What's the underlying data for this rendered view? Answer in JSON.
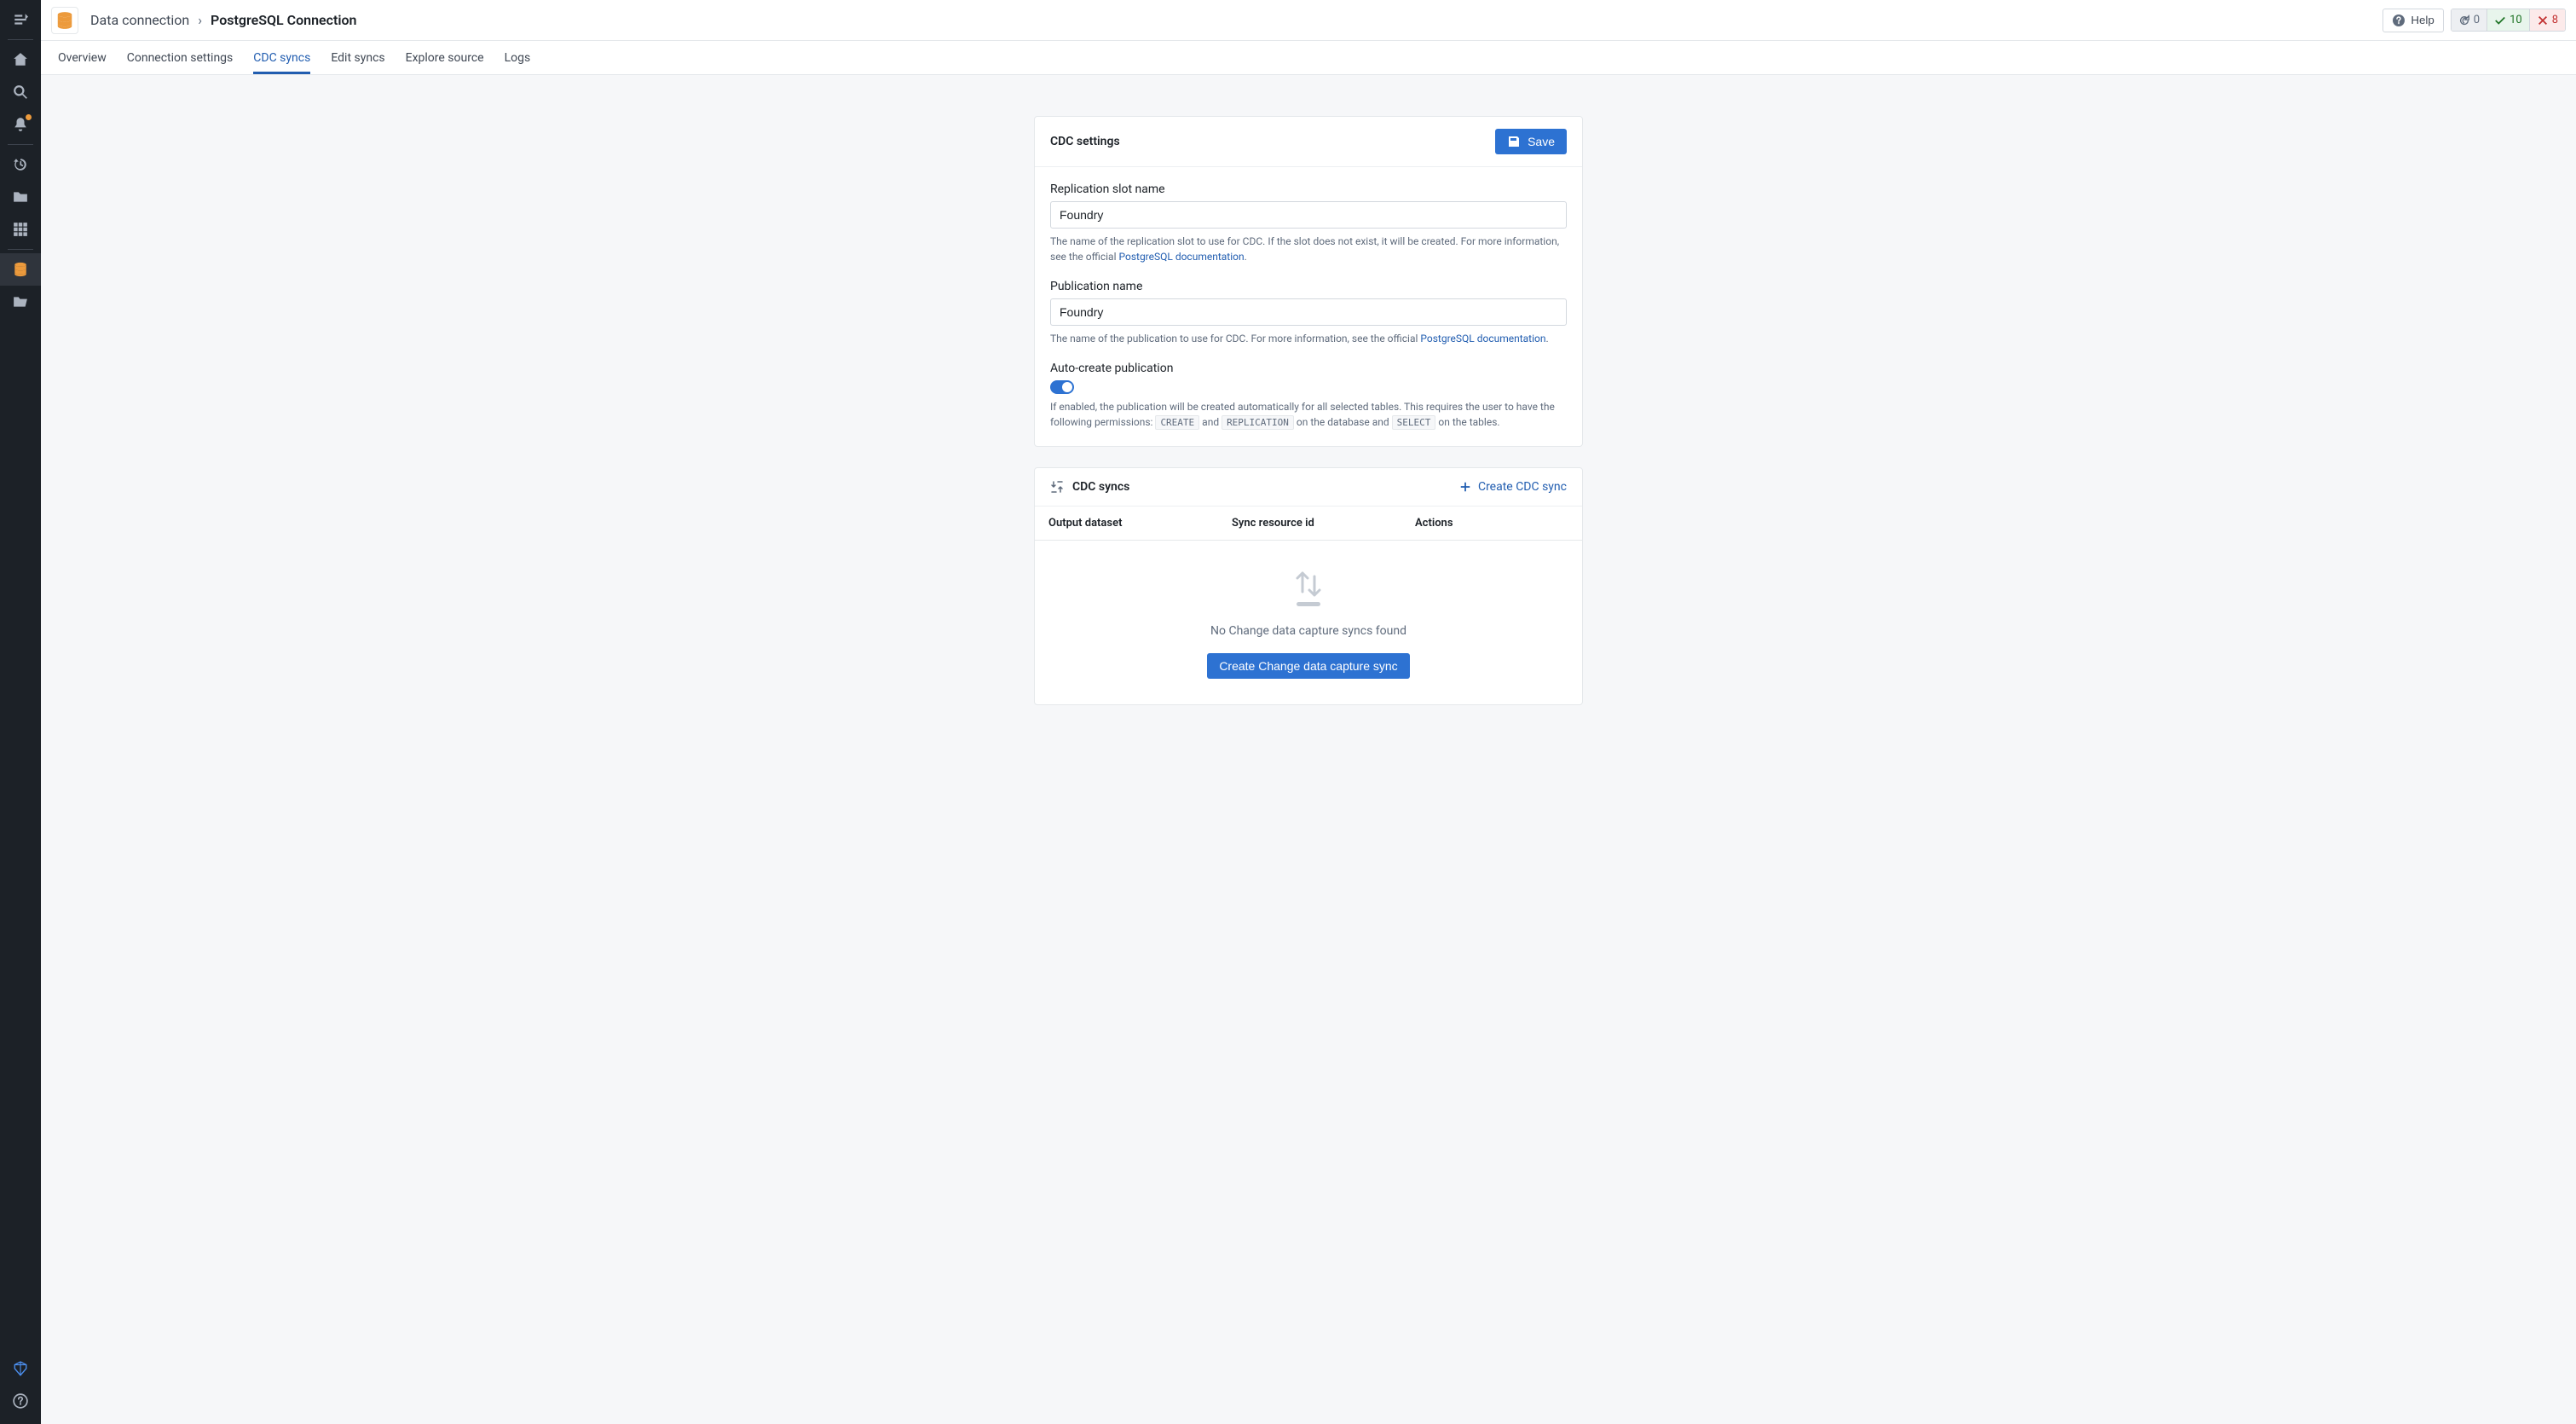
{
  "breadcrumb": {
    "parent": "Data connection",
    "current": "PostgreSQL Connection"
  },
  "header": {
    "help": "Help",
    "status_refresh": "0",
    "status_success": "10",
    "status_error": "8"
  },
  "tabs": [
    "Overview",
    "Connection settings",
    "CDC syncs",
    "Edit syncs",
    "Explore source",
    "Logs"
  ],
  "cdc_settings": {
    "title": "CDC settings",
    "save": "Save",
    "replication_slot": {
      "label": "Replication slot name",
      "value": "Foundry",
      "help_prefix": "The name of the replication slot to use for CDC. If the slot does not exist, it will be created. For more information, see the official ",
      "help_link": "PostgreSQL documentation",
      "help_suffix": "."
    },
    "publication": {
      "label": "Publication name",
      "value": "Foundry",
      "help_prefix": "The name of the publication to use for CDC. For more information, see the official ",
      "help_link": "PostgreSQL documentation",
      "help_suffix": "."
    },
    "auto_create": {
      "label": "Auto-create publication",
      "help_p1": "If enabled, the publication will be created automatically for all selected tables. This requires the user to have the following permissions: ",
      "perm_create": "CREATE",
      "help_and": " and ",
      "perm_replication": "REPLICATION",
      "help_p2": " on the database and ",
      "perm_select": "SELECT",
      "help_p3": " on the tables."
    }
  },
  "cdc_syncs": {
    "title": "CDC syncs",
    "create_link": "Create CDC sync",
    "columns": [
      "Output dataset",
      "Sync resource id",
      "Actions"
    ],
    "empty_text": "No Change data capture syncs found",
    "empty_button": "Create Change data capture sync"
  }
}
